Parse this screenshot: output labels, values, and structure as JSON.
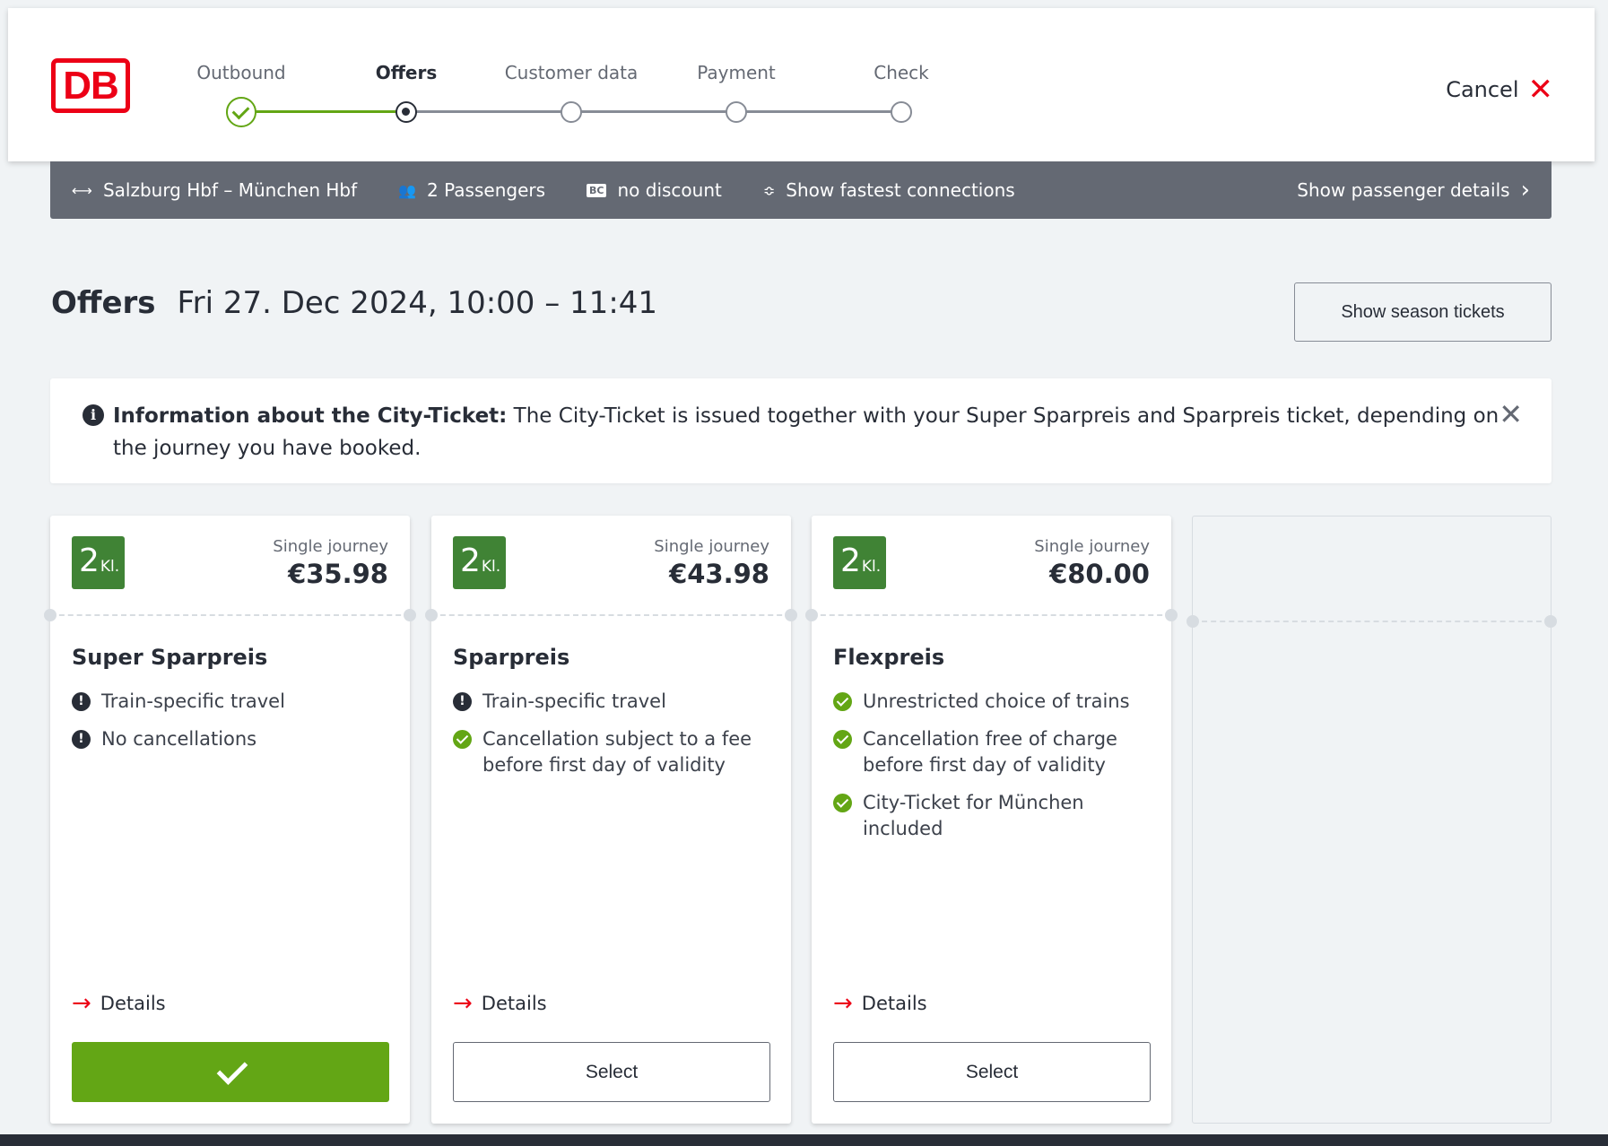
{
  "header": {
    "logo_text": "DB",
    "steps": [
      {
        "label": "Outbound",
        "state": "done"
      },
      {
        "label": "Offers",
        "state": "active"
      },
      {
        "label": "Customer data",
        "state": "pending"
      },
      {
        "label": "Payment",
        "state": "pending"
      },
      {
        "label": "Check",
        "state": "pending"
      }
    ],
    "cancel_label": "Cancel"
  },
  "summary": {
    "route": "Salzburg Hbf – München Hbf",
    "passengers": "2 Passengers",
    "discount_badge": "BC",
    "discount": "no discount",
    "connections": "Show fastest connections",
    "passenger_details": "Show passenger details"
  },
  "offers": {
    "title": "Offers",
    "date": "Fri 27. Dec 2024, 10:00 – 11:41",
    "season_button": "Show season tickets"
  },
  "info": {
    "title": "Information about the City-Ticket:",
    "text": "The City-Ticket is issued together with your Super Sparpreis and Sparpreis ticket, depending on the journey you have booked."
  },
  "cards": [
    {
      "class_num": "2",
      "class_suffix": "Kl.",
      "price_label": "Single journey",
      "price": "€35.98",
      "name": "Super Sparpreis",
      "features": [
        {
          "type": "warn",
          "text": "Train-specific travel"
        },
        {
          "type": "warn",
          "text": "No cancellations"
        }
      ],
      "details_label": "Details",
      "select_label": "",
      "selected": true
    },
    {
      "class_num": "2",
      "class_suffix": "Kl.",
      "price_label": "Single journey",
      "price": "€43.98",
      "name": "Sparpreis",
      "features": [
        {
          "type": "warn",
          "text": "Train-specific travel"
        },
        {
          "type": "ok",
          "text": "Cancellation subject to a fee before first day of validity"
        }
      ],
      "details_label": "Details",
      "select_label": "Select",
      "selected": false
    },
    {
      "class_num": "2",
      "class_suffix": "Kl.",
      "price_label": "Single journey",
      "price": "€80.00",
      "name": "Flexpreis",
      "features": [
        {
          "type": "ok",
          "text": "Unrestricted choice of trains"
        },
        {
          "type": "ok",
          "text": "Cancellation free of charge before first day of validity"
        },
        {
          "type": "ok",
          "text": "City-Ticket for München included"
        }
      ],
      "details_label": "Details",
      "select_label": "Select",
      "selected": false
    }
  ],
  "colors": {
    "db_red": "#ec0016",
    "success_green": "#63a615",
    "class_badge_green": "#408335",
    "summary_bar": "#646973"
  }
}
